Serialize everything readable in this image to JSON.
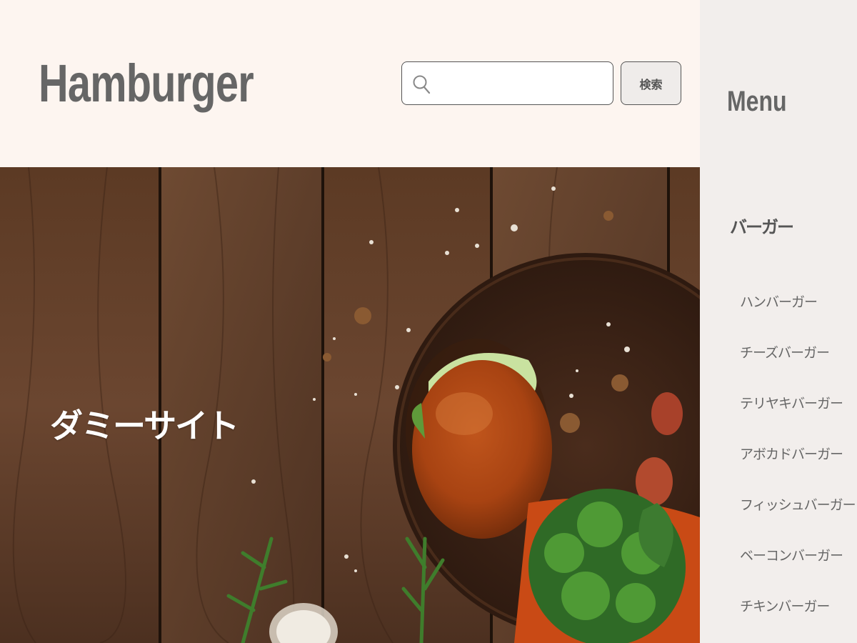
{
  "header": {
    "logo": "Hamburger",
    "search": {
      "placeholder": "",
      "value": ""
    },
    "search_button": "検索"
  },
  "hero": {
    "title": "ダミーサイト"
  },
  "sidebar": {
    "title": "Menu",
    "category": "バーガー",
    "items": [
      {
        "label": "ハンバーガー"
      },
      {
        "label": "チーズバーガー"
      },
      {
        "label": "テリヤキバーガー"
      },
      {
        "label": "アボカドバーガー"
      },
      {
        "label": "フィッシュバーガー"
      },
      {
        "label": "ベーコンバーガー"
      },
      {
        "label": "チキンバーガー"
      }
    ]
  },
  "colors": {
    "header_bg": "#fdf5f0",
    "sidebar_bg": "#f2eeec",
    "text_gray": "#666666",
    "wood_dark": "#4a2e1c"
  }
}
